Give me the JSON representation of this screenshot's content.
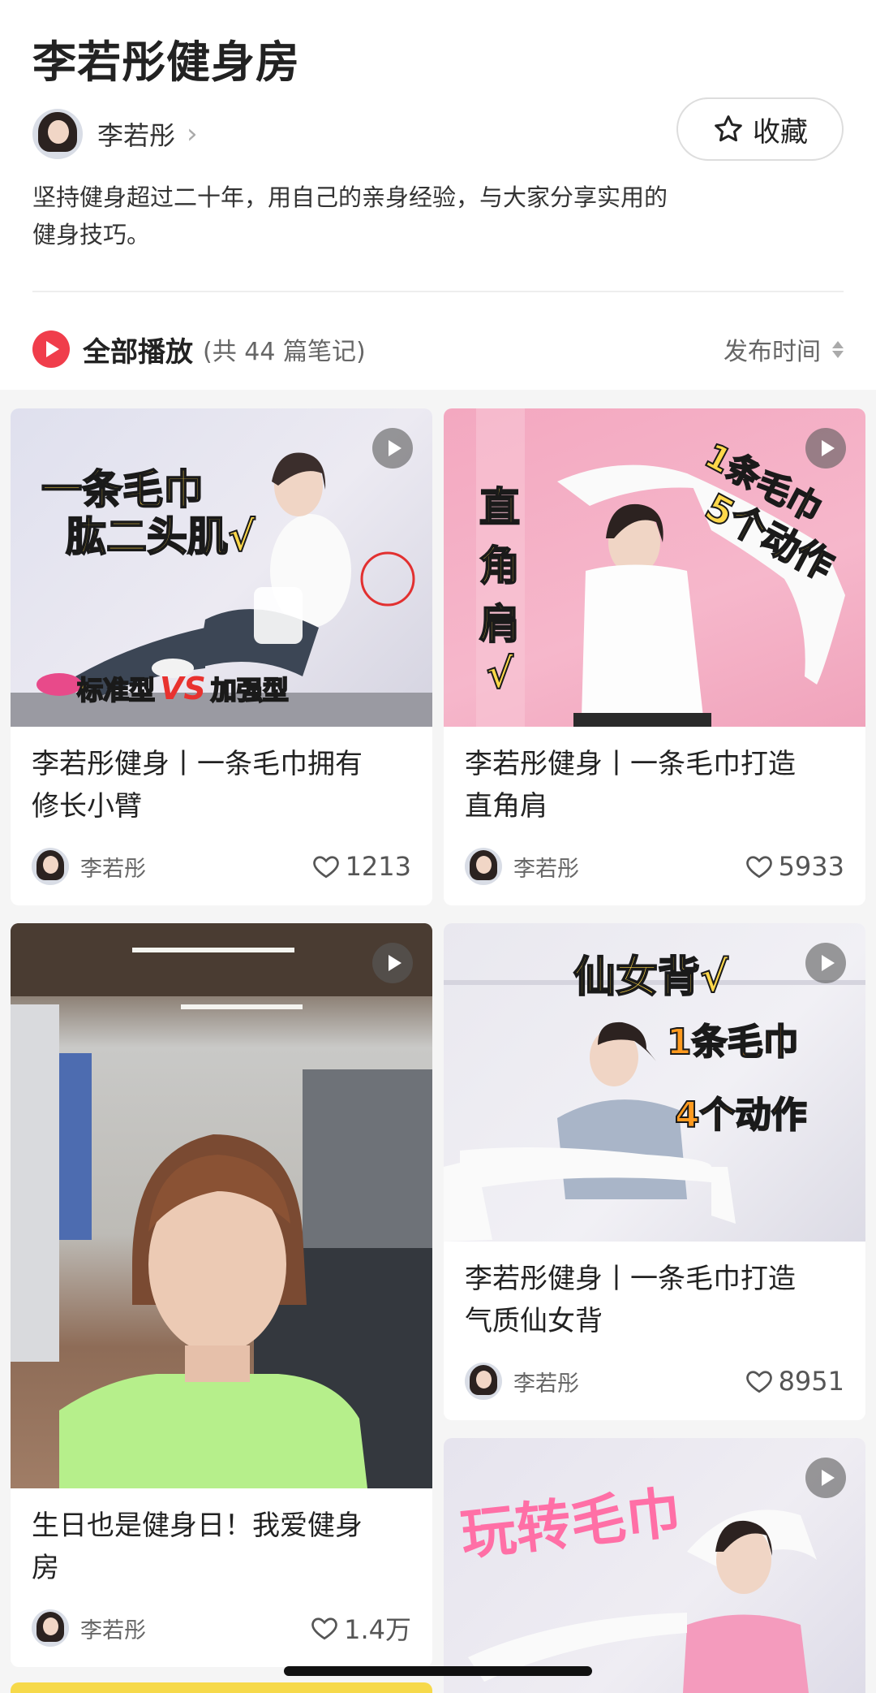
{
  "collection": {
    "title": "李若彤健身房",
    "author": "李若彤",
    "favorite_label": "收藏",
    "description_line1": "坚持健身超过二十年，用自己的亲身经验，与大家分享实用的",
    "description_line2": "健身技巧。",
    "play_all_label": "全部播放",
    "note_count": "(共 44 篇笔记)",
    "sort_label": "发布时间"
  },
  "notes": [
    {
      "title_line1": "李若彤健身丨一条毛巾拥有",
      "title_line2": "修长小臂",
      "author": "李若彤",
      "likes": "1213",
      "overlay": [
        "一条毛巾",
        "肱二头肌√",
        "标准型",
        "VS",
        "加强型"
      ]
    },
    {
      "title_line1": "李若彤健身丨一条毛巾打造",
      "title_line2": "直角肩",
      "author": "李若彤",
      "likes": "5933",
      "overlay": [
        "直",
        "角",
        "肩",
        "√",
        "1条毛巾",
        "5个动作"
      ]
    },
    {
      "title_line1": "生日也是健身日！我爱健身",
      "title_line2": "房",
      "author": "李若彤",
      "likes": "1.4万",
      "overlay": []
    },
    {
      "title_line1": "李若彤健身丨一条毛巾打造",
      "title_line2": "气质仙女背",
      "author": "李若彤",
      "likes": "8951",
      "overlay": [
        "仙女背√",
        "1条毛巾",
        "4个动作"
      ]
    },
    {
      "title_line1": "",
      "title_line2": "",
      "author": "",
      "likes": "",
      "overlay": [
        "玩转毛巾"
      ]
    }
  ],
  "colors": {
    "accent": "#f03d4b",
    "background": "#f5f5f5",
    "overlay_yellow": "#ffd84a"
  },
  "icons": [
    "chevron-right-icon",
    "star-outline-icon",
    "play-icon",
    "video-play-icon",
    "heart-outline-icon"
  ]
}
